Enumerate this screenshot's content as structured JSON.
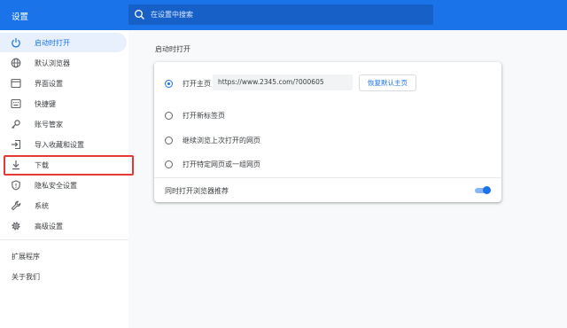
{
  "app": {
    "title": "设置"
  },
  "search": {
    "placeholder": "在设置中搜索"
  },
  "sidebar": {
    "items": [
      {
        "label": "启动时打开",
        "icon": "power-icon",
        "active": true
      },
      {
        "label": "默认浏览器",
        "icon": "globe-icon"
      },
      {
        "label": "界面设置",
        "icon": "browser-window-icon"
      },
      {
        "label": "快捷键",
        "icon": "keyboard-icon"
      },
      {
        "label": "账号管家",
        "icon": "key-icon"
      },
      {
        "label": "导入收藏和设置",
        "icon": "import-icon"
      },
      {
        "label": "下载",
        "icon": "download-icon",
        "highlighted": true
      },
      {
        "label": "隐私安全设置",
        "icon": "shield-icon"
      },
      {
        "label": "系统",
        "icon": "wrench-icon"
      },
      {
        "label": "高级设置",
        "icon": "gear-icon"
      }
    ],
    "extensions_label": "扩展程序",
    "about_label": "关于我们"
  },
  "main": {
    "section_title": "启动时打开",
    "options": [
      {
        "label": "打开主页",
        "checked": true
      },
      {
        "label": "打开新标签页",
        "checked": false
      },
      {
        "label": "继续浏览上次打开的网页",
        "checked": false
      },
      {
        "label": "打开特定网页或一组网页",
        "checked": false
      }
    ],
    "homepage_url": "https://www.2345.com/?000605",
    "restore_button": "恢复默认主页",
    "recommend_label": "同时打开浏览器推荐",
    "recommend_enabled": true
  },
  "colors": {
    "accent": "#1a73e8",
    "highlight_border": "#e53935"
  }
}
